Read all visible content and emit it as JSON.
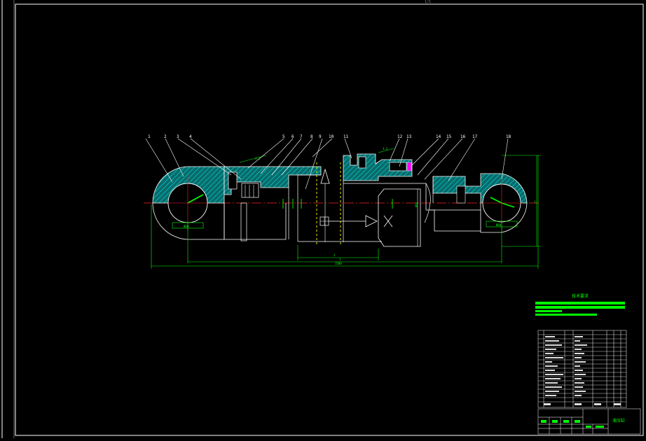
{
  "drawing": {
    "window_caption": "1/1",
    "balloons": [
      "1",
      "2",
      "3",
      "4",
      "5",
      "6",
      "7",
      "8",
      "9",
      "10",
      "11",
      "12",
      "13",
      "14",
      "15",
      "16",
      "17",
      "18"
    ],
    "dims": {
      "overall_length": "1500",
      "stroke_length": "1",
      "center_length": "1",
      "pin_left": "Ø60",
      "pin_right": "Ø60",
      "height": "1",
      "rod_dia": "Ø80",
      "roughness": "3.2"
    }
  },
  "title_block": {
    "requirements_heading": "技术要求",
    "drawing_name": "液压缸"
  },
  "colors": {
    "background": "#000000",
    "outline": "#ffffff",
    "hatch": "#00c8c8",
    "dimension": "#00ff00",
    "centerline": "#ff2020",
    "hidden": "#ffff00",
    "seal": "#ff00ff"
  }
}
